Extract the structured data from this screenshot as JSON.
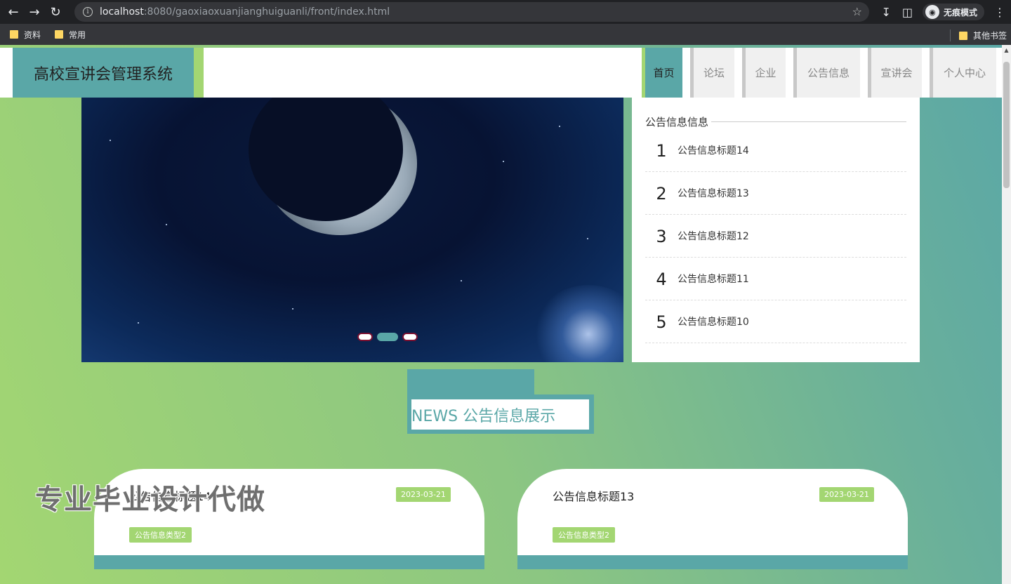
{
  "browser": {
    "url_host": "localhost",
    "url_rest": ":8080/gaoxiaoxuanjianghuiguanli/front/index.html",
    "incognito_label": "无痕模式",
    "bookmarks": [
      "资料",
      "常用"
    ],
    "other_bookmarks": "其他书签"
  },
  "site": {
    "title": "高校宣讲会管理系统",
    "nav": [
      "首页",
      "论坛",
      "企业",
      "公告信息",
      "宣讲会",
      "个人中心"
    ],
    "active_nav": "首页"
  },
  "notice_panel": {
    "title": "公告信息信息",
    "items": [
      {
        "num": "1",
        "title": "公告信息标题14"
      },
      {
        "num": "2",
        "title": "公告信息标题13"
      },
      {
        "num": "3",
        "title": "公告信息标题12"
      },
      {
        "num": "4",
        "title": "公告信息标题11"
      },
      {
        "num": "5",
        "title": "公告信息标题10"
      }
    ]
  },
  "carousel": {
    "count": 3,
    "active": 1
  },
  "news_section": {
    "heading": "NEWS 公告信息展示"
  },
  "cards": [
    {
      "title": "公告信息标题14",
      "date": "2023-03-21",
      "tag": "公告信息类型2"
    },
    {
      "title": "公告信息标题13",
      "date": "2023-03-21",
      "tag": "公告信息类型2"
    }
  ],
  "watermark": "专业毕业设计代做",
  "colors": {
    "primary": "#5aa7a7",
    "accent": "#a3d672"
  }
}
